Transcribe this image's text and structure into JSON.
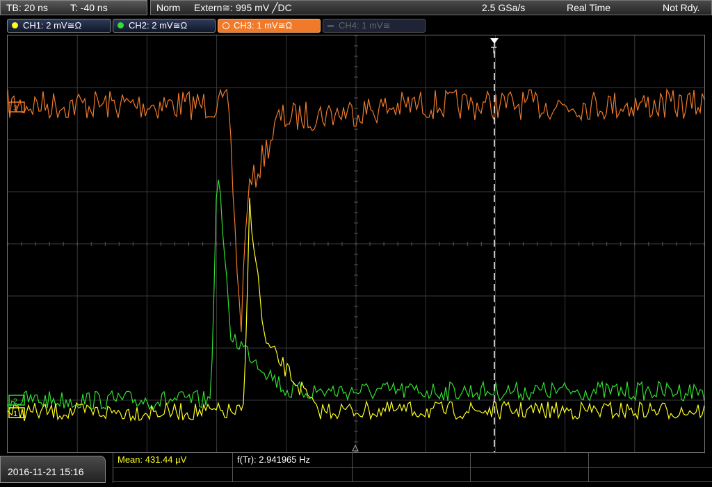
{
  "timebase": {
    "tb": "TB: 20 ns",
    "trigger_time": "T: -40 ns"
  },
  "status": {
    "mode": "Norm",
    "trigger": "Extern≅: 995 mV ╱DC",
    "sample_rate": "2.5 GSa/s",
    "acq_mode": "Real Time",
    "ready": "Not Rdy."
  },
  "channels": [
    {
      "label": "CH1: 2 mV≅Ω",
      "color": "#ffff20",
      "state": "on"
    },
    {
      "label": "CH2: 2 mV≅Ω",
      "color": "#30e030",
      "state": "on"
    },
    {
      "label": "CH3: 1 mV≅Ω",
      "color": "#ffffff",
      "state": "selected"
    },
    {
      "label": "CH4: 1 mV≅",
      "color": "#666666",
      "state": "off"
    }
  ],
  "markers": {
    "trigger": "T",
    "ch3_ref": "3",
    "ch2_ref": "2",
    "ch1_ref": "1"
  },
  "measurements": {
    "mean": "Mean: 431.44 µV",
    "freq": "f(Tr): 2.941965 Hz"
  },
  "timestamp": "2016-11-21 15:16",
  "colors": {
    "ch1": "#ffff20",
    "ch2": "#30e030",
    "ch3": "#f07a2a",
    "grid": "#3a3a3a"
  }
}
